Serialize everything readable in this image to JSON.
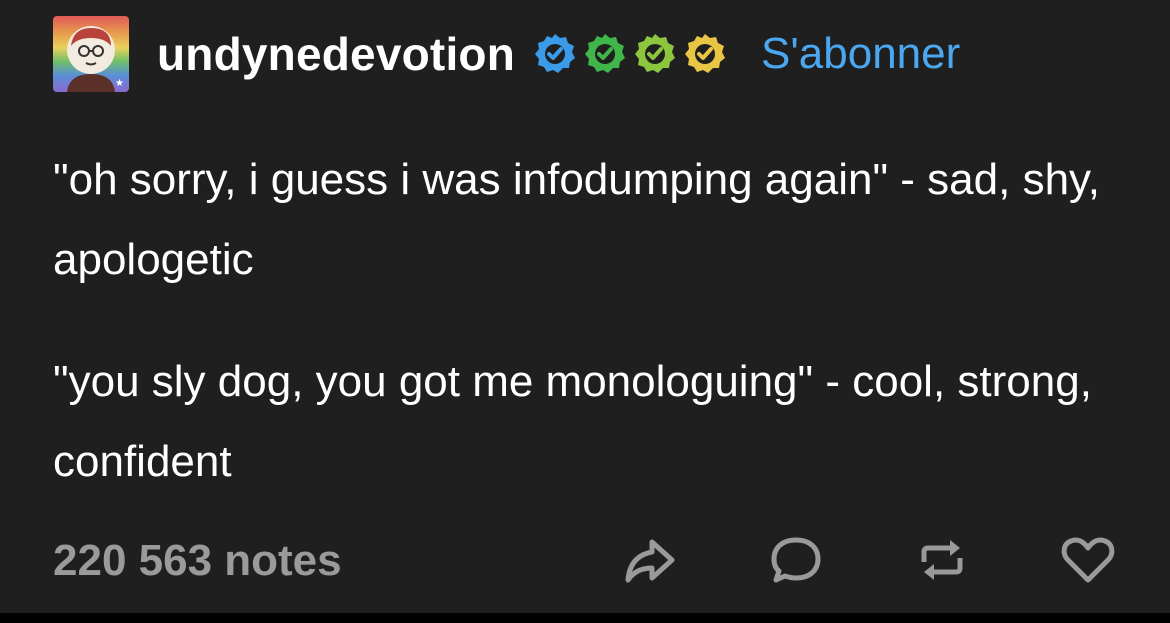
{
  "post": {
    "username": "undynedevotion",
    "follow_label": "S'abonner",
    "badges": [
      {
        "icon": "verified-check-icon",
        "color": "#3b9be8"
      },
      {
        "icon": "verified-check-icon",
        "color": "#3fb54a"
      },
      {
        "icon": "verified-check-icon",
        "color": "#8cc63f"
      },
      {
        "icon": "verified-check-icon",
        "color": "#e8c544"
      }
    ],
    "paragraphs": [
      "\"oh sorry, i guess i was infodumping again\" - sad, shy, apologetic",
      "\"you sly dog, you got me monologuing\" - cool, strong, confident"
    ],
    "notes": "220 563 notes",
    "actions": [
      "share-icon",
      "comment-icon",
      "reblog-icon",
      "like-heart-icon"
    ]
  },
  "theme": {
    "background": "#1f1f1f",
    "accent": "#4aa7f0",
    "muted": "#9a9a9a"
  }
}
